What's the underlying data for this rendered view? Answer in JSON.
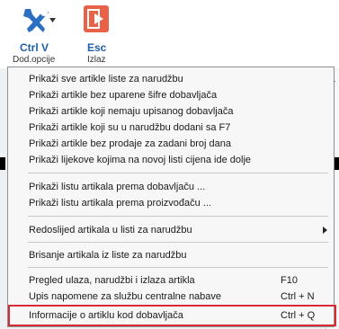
{
  "toolbar": {
    "ctrlv": {
      "key": "Ctrl V",
      "label": "Dod.opcije",
      "icon": "wrench-icon"
    },
    "esc": {
      "key": "Esc",
      "label": "Izlaz",
      "icon": "exit-icon"
    }
  },
  "menu": {
    "items": [
      {
        "label": "Prikaži sve artikle liste za narudžbu"
      },
      {
        "label": "Prikaži artikle bez uparene šifre dobavljača"
      },
      {
        "label": "Prikaži artikle koji nemaju upisanog dobavljača"
      },
      {
        "label": "Prikaži artikle koji su u narudžbu dodani sa F7"
      },
      {
        "label": "Prikaži artikle bez prodaje za zadani broj dana"
      },
      {
        "label": "Prikaži lijekove kojima na novoj listi cijena ide dolje"
      },
      {
        "label": "Prikaži listu artikala prema dobavljaču ..."
      },
      {
        "label": "Prikaži listu artikala prema proizvođaču ..."
      },
      {
        "label": "Redoslijed artikala u listi za narudžbu"
      },
      {
        "label": "Brisanje artikala iz liste za narudžbu"
      },
      {
        "label": "Pregled ulaza, narudžbi i izlaza artikla",
        "shortcut": "F10"
      },
      {
        "label": "Upis napomene za službu centralne nabave",
        "shortcut": "Ctrl + N"
      },
      {
        "label": "Informacije o artiklu kod dobavljača",
        "shortcut": "Ctrl + Q"
      }
    ]
  },
  "colors": {
    "accent": "#1f5fa8",
    "highlight": "#d72c33",
    "esc_icon": "#e8624a"
  }
}
